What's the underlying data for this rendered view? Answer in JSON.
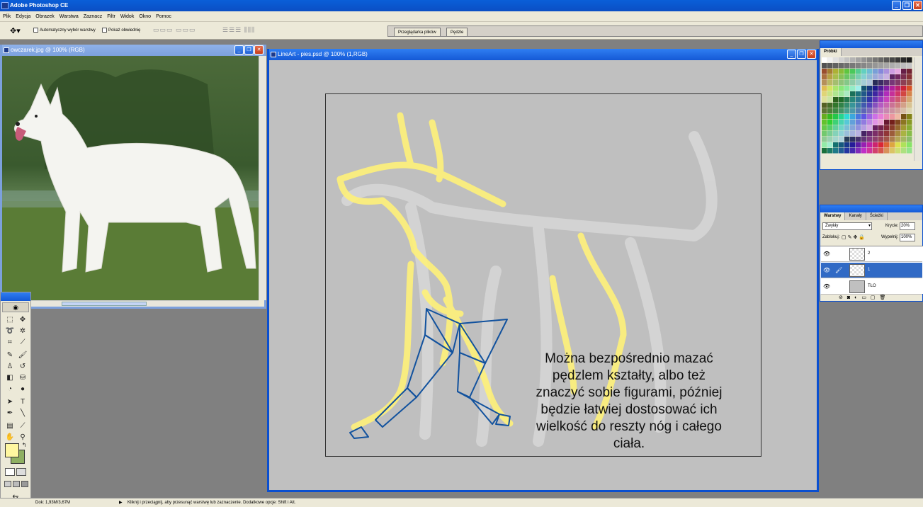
{
  "app": {
    "title": "Adobe Photoshop CE"
  },
  "menu": [
    "Plik",
    "Edycja",
    "Obrazek",
    "Warstwa",
    "Zaznacz",
    "Filtr",
    "Widok",
    "Okno",
    "Pomoc"
  ],
  "options": {
    "auto_select_label": "Automatyczny wybór warstwy",
    "show_bounds_label": "Pokaż obwiednię"
  },
  "palette_well": {
    "tabs": [
      "Przeglądarka plików",
      "Pędzle"
    ]
  },
  "photo_window": {
    "title": "owczarek.jpg @ 100% (RGB)"
  },
  "lineart_window": {
    "title": "LineArt - pies.psd @ 100% (1,RGB)",
    "caption": "Można bezpośrednio mazać pędzlem kształty, albo też znaczyć sobie figurami, później będzie łatwiej dostosować ich wielkość do reszty nóg i całego ciała."
  },
  "swatches_palette": {
    "tab": "Próbki"
  },
  "layers_palette": {
    "tabs": [
      "Warstwy",
      "Kanały",
      "Ścieżki"
    ],
    "blend_mode": "Zwykły",
    "opacity_label": "Krycie:",
    "opacity_value": "20%",
    "lock_label": "Zablokuj:",
    "fill_label": "Wypełnij:",
    "fill_value": "100%",
    "layers": [
      {
        "name": "2",
        "selected": false
      },
      {
        "name": "1",
        "selected": true
      },
      {
        "name": "TŁO",
        "selected": false
      }
    ]
  },
  "status": {
    "doc_size": "Dok: 1,93M/3,67M",
    "hint": "Kliknij i przeciągnij, aby przesunąć warstwę lub zaznaczenie. Dodatkowe opcje: Shift i Alt."
  },
  "colors": {
    "titlebar_blue": "#0b54d0",
    "foreground": "#fff7a0",
    "background": "#8faf62",
    "sketch_yellow": "#fff17a",
    "figure_blue": "#12529e"
  }
}
